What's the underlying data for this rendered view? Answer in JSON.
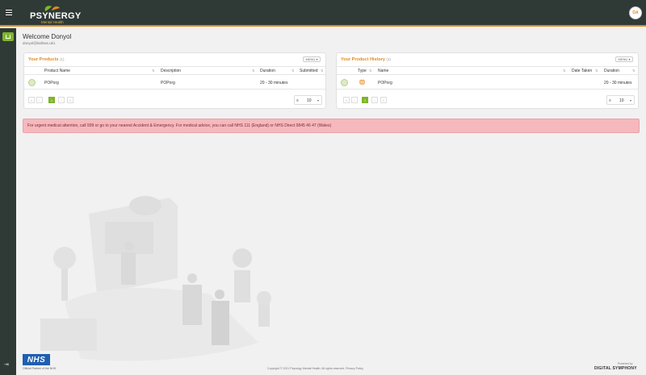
{
  "app": {
    "logo_text": "PSYNERGY",
    "logo_sub": "Mental Health",
    "avatar_initials": "DA"
  },
  "user": {
    "welcome": "Welcome Donyol",
    "email": "donyol@kallnas.uk1"
  },
  "products_panel": {
    "title": "Your Products",
    "count": "(1)",
    "menu_label": "MENU",
    "columns": [
      "Product Name",
      "Description",
      "Duration",
      "Submitted"
    ],
    "rows": [
      {
        "name": "POPorg",
        "description": "POPorg",
        "duration": "20 - 30 minutes",
        "submitted": ""
      }
    ],
    "page_prev_first": "«",
    "page_prev": "‹",
    "page_current": "1",
    "page_next": "›",
    "page_next_last": "»",
    "page_size": "10"
  },
  "history_panel": {
    "title": "Your Product History",
    "count": "(1)",
    "menu_label": "MENU",
    "columns": [
      "Type",
      "Name",
      "Date Taken",
      "Duration"
    ],
    "rows": [
      {
        "type": "",
        "name": "POPorg",
        "date_taken": "",
        "duration": "20 - 30 minutes"
      }
    ],
    "page_prev_first": "«",
    "page_prev": "‹",
    "page_current": "1",
    "page_next": "›",
    "page_next_last": "»",
    "page_size": "10"
  },
  "alert": {
    "text": "For urgent medical attention, call 999 or go to your nearest Accident & Emergency. For medical advice, you can call NHS 111 (England) or NHS Direct 0845 46 47 (Wales)"
  },
  "footer": {
    "nhs_logo": "NHS",
    "nhs_sub": "Official Partner of the NHS",
    "copyright": "Copyright © 2021 Psynergy Mental Health. All rights reserved. Privacy Policy",
    "powered_by": "Powered by",
    "powered_logo": "DIGITAL SYMPHONY"
  },
  "colors": {
    "topbar": "#2f3a36",
    "accent_orange": "#e08a1e",
    "accent_green": "#7fb52a",
    "alert_bg": "#f5b8bd"
  },
  "icons": {
    "menu": "hamburger-icon",
    "home": "home-icon",
    "logout": "logout-icon",
    "sort": "sort-icon"
  }
}
